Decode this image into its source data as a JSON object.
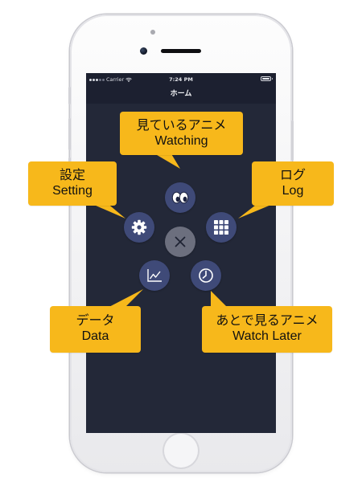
{
  "status_bar": {
    "carrier": "Carrier",
    "time": "7:24 PM",
    "battery_level": 1.0
  },
  "navigation": {
    "title": "ホーム"
  },
  "menu": {
    "buttons": [
      {
        "id": "watching",
        "icon": "eyes-icon"
      },
      {
        "id": "log",
        "icon": "grid-icon"
      },
      {
        "id": "watch-later",
        "icon": "clock-icon"
      },
      {
        "id": "data",
        "icon": "line-chart-icon"
      },
      {
        "id": "setting",
        "icon": "gear-icon"
      },
      {
        "id": "close",
        "icon": "close-icon"
      }
    ]
  },
  "callouts": {
    "watching": {
      "ja": "見ているアニメ",
      "en": "Watching"
    },
    "setting": {
      "ja": "設定",
      "en": "Setting"
    },
    "log": {
      "ja": "ログ",
      "en": "Log"
    },
    "data": {
      "ja": "データ",
      "en": "Data"
    },
    "watch_later": {
      "ja": "あとで見るアニメ",
      "en": "Watch Later"
    }
  },
  "colors": {
    "screen_background": "#232838",
    "navbar_background": "#1c2030",
    "menu_button": "#3f4a78",
    "close_button": "#6c6f7e",
    "callout": "#f7b81b"
  }
}
